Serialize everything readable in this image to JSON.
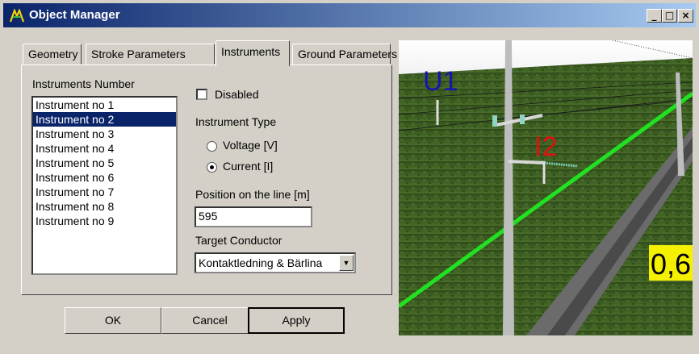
{
  "window": {
    "title": "Object Manager",
    "minimize": "_",
    "maximize": "□",
    "close": "×"
  },
  "tabs": [
    {
      "label": "Geometry"
    },
    {
      "label": "Stroke Parameters"
    },
    {
      "label": "Instruments"
    },
    {
      "label": "Ground Parameters"
    }
  ],
  "instruments": {
    "list_label": "Instruments Number",
    "items": [
      "Instrument no 1",
      "Instrument no 2",
      "Instrument no 3",
      "Instrument no 4",
      "Instrument no 5",
      "Instrument no 6",
      "Instrument no 7",
      "Instrument no 8",
      "Instrument no 9"
    ],
    "selected": "Instrument no 2",
    "disabled_label": "Disabled",
    "disabled_checked": false,
    "type_label": "Instrument Type",
    "voltage_label": "Voltage [V]",
    "current_label": "Current [I]",
    "selected_type": "current",
    "position_label": "Position on the line [m]",
    "position_value": "595",
    "conductor_label": "Target Conductor",
    "conductor_value": "Kontaktledning & Bärlina"
  },
  "buttons": {
    "ok": "OK",
    "cancel": "Cancel",
    "apply": "Apply"
  },
  "scene": {
    "label_u1": "U1",
    "label_i2": "I2",
    "sign_text": "0,6",
    "colors": {
      "u1": "#1515b0",
      "i2": "#e01010",
      "line": "#22e022",
      "sign": "#f5f000"
    }
  }
}
